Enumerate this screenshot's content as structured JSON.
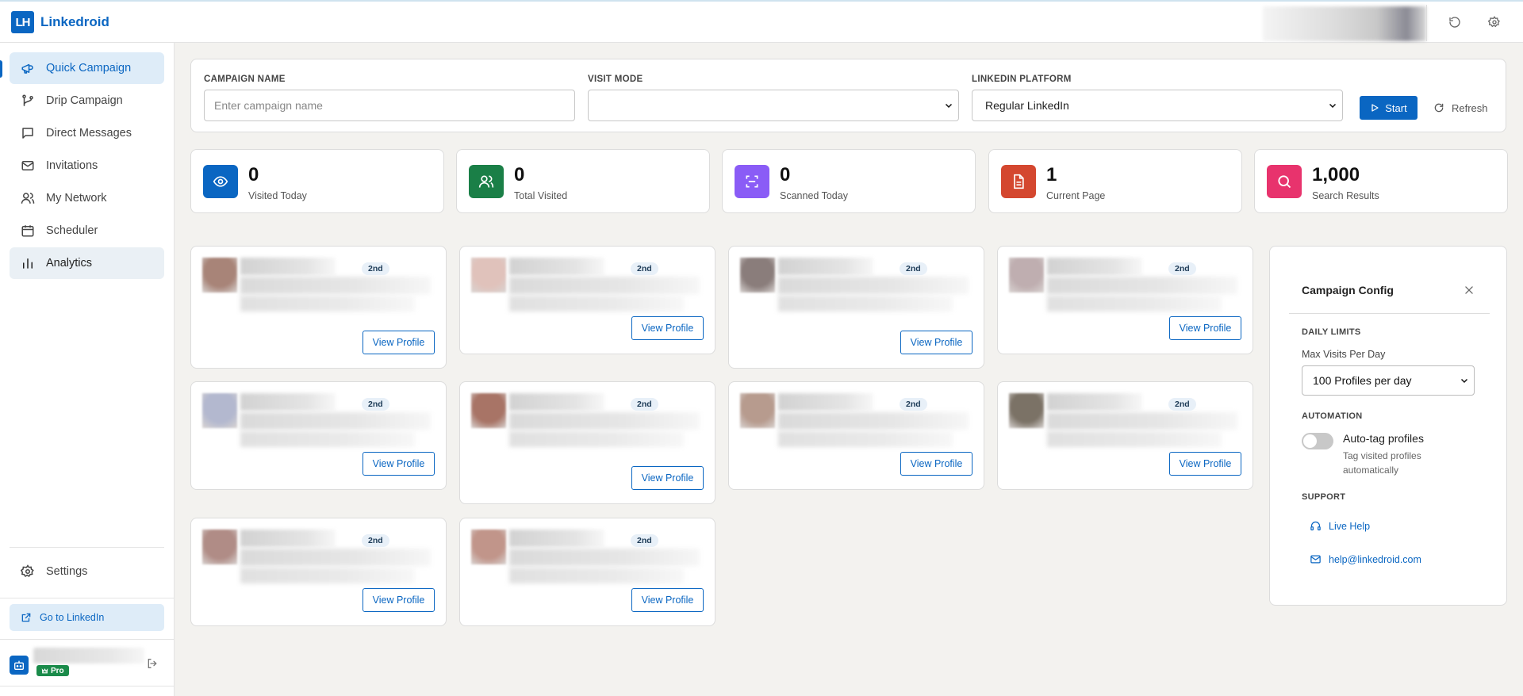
{
  "app": {
    "logo_text": "LH",
    "name": "Linkedroid"
  },
  "sidebar": {
    "items": [
      {
        "label": "Quick Campaign",
        "icon": "megaphone-icon",
        "active": true
      },
      {
        "label": "Drip Campaign",
        "icon": "branch-icon"
      },
      {
        "label": "Direct Messages",
        "icon": "message-icon"
      },
      {
        "label": "Invitations",
        "icon": "mail-icon"
      },
      {
        "label": "My Network",
        "icon": "users-icon"
      },
      {
        "label": "Scheduler",
        "icon": "calendar-icon"
      },
      {
        "label": "Analytics",
        "icon": "bar-chart-icon"
      }
    ],
    "settings_label": "Settings",
    "goto_label": "Go to LinkedIn",
    "plan_badge": "Pro"
  },
  "campaign_form": {
    "name_label": "CAMPAIGN NAME",
    "name_placeholder": "Enter campaign name",
    "name_value": "",
    "visit_mode_label": "VISIT MODE",
    "visit_mode_value": "",
    "platform_label": "LINKEDIN PLATFORM",
    "platform_value": "Regular LinkedIn",
    "start_label": "Start",
    "refresh_label": "Refresh"
  },
  "stats": [
    {
      "value": "0",
      "label": "Visited Today",
      "color": "#0a66c2",
      "icon": "eye-icon"
    },
    {
      "value": "0",
      "label": "Total Visited",
      "color": "#1a7f47",
      "icon": "users-icon"
    },
    {
      "value": "0",
      "label": "Scanned Today",
      "color": "#8a5cf6",
      "icon": "scan-icon"
    },
    {
      "value": "1",
      "label": "Current Page",
      "color": "#d4472f",
      "icon": "document-icon"
    },
    {
      "value": "1,000",
      "label": "Search Results",
      "color": "#e8336d",
      "icon": "search-icon"
    }
  ],
  "profiles": {
    "degree_label": "2nd",
    "view_label": "View Profile",
    "cards": [
      {
        "avatar_color": "#a88478"
      },
      {
        "avatar_color": "#e0c2bb"
      },
      {
        "avatar_color": "#8a7d7b"
      },
      {
        "avatar_color": "#bfaeb0"
      },
      {
        "avatar_color": "#b3b8cf"
      },
      {
        "avatar_color": "#a87466"
      },
      {
        "avatar_color": "#b79b8e"
      },
      {
        "avatar_color": "#7b7266"
      },
      {
        "avatar_color": "#b08c86"
      },
      {
        "avatar_color": "#c1958a"
      }
    ]
  },
  "config": {
    "title": "Campaign Config",
    "daily_limits_label": "DAILY LIMITS",
    "max_visits_label": "Max Visits Per Day",
    "max_visits_value": "100 Profiles per day",
    "automation_label": "AUTOMATION",
    "auto_tag_title": "Auto-tag profiles",
    "auto_tag_desc": "Tag visited profiles automatically",
    "auto_tag_enabled": false,
    "support_label": "SUPPORT",
    "live_help_label": "Live Help",
    "email_label": "help@linkedroid.com"
  }
}
